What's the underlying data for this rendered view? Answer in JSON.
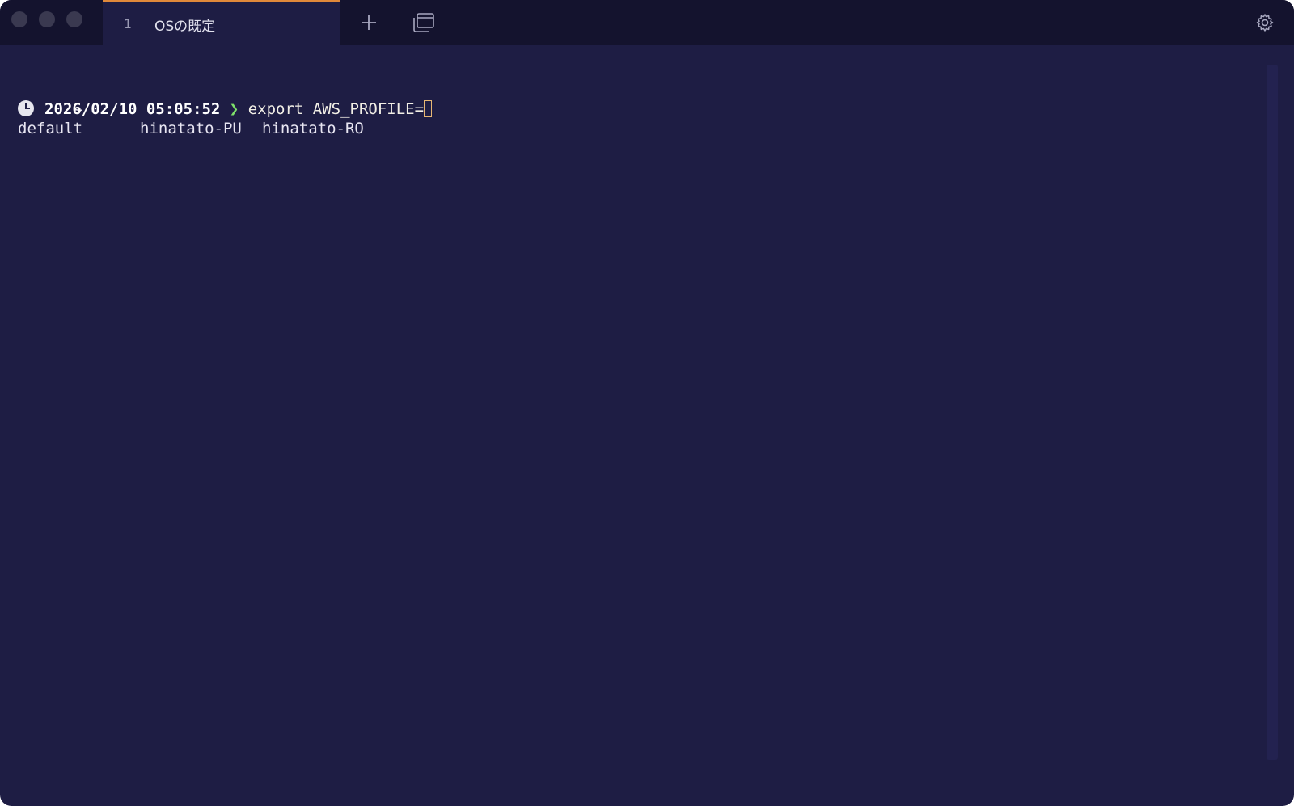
{
  "tab": {
    "index": "1",
    "title": "OSの既定"
  },
  "toolbar": {
    "new_tab_icon": "plus-icon",
    "windows_icon": "windows-icon",
    "settings_icon": "gear-icon"
  },
  "terminal": {
    "cwd": "~",
    "prompt_icon": "clock-icon",
    "timestamp": "2026/02/10 05:05:52",
    "prompt_symbol": "❯",
    "command": "export AWS_PROFILE=",
    "completions": [
      "default",
      "hinatato-PU",
      "hinatato-RO"
    ]
  },
  "colors": {
    "background": "#1e1d44",
    "titlebar": "#14132e",
    "tab_accent": "#e0893a",
    "prompt_symbol": "#7ee06a",
    "cursor": "#e7b774"
  }
}
